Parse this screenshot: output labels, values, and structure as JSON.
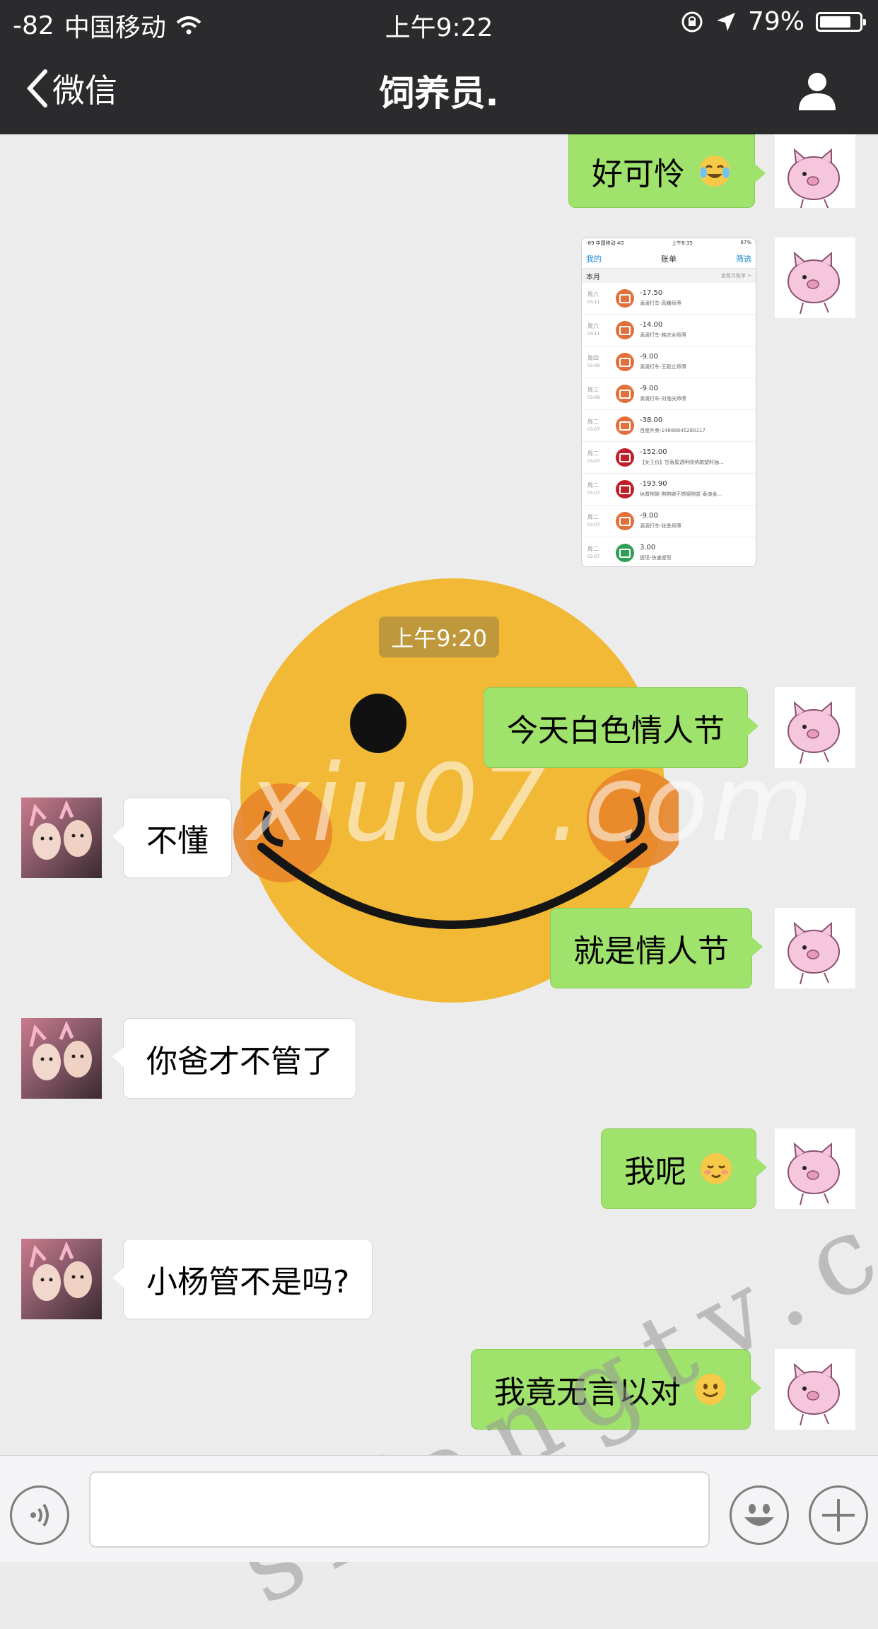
{
  "status_bar": {
    "signal": "-82",
    "carrier": "中国移动",
    "time": "上午9:22",
    "battery": "79%",
    "battery_level": 0.79
  },
  "nav": {
    "back_label": "微信",
    "title": "饲养员."
  },
  "screenshot_image": {
    "status_left": "-89 中国移动  4G",
    "status_time": "上午8:35",
    "status_right": "67%",
    "back_label": "我的",
    "title": "账单",
    "filter_label": "筛选",
    "month_label": "本月",
    "month_right": "查看月账单 >",
    "rows": [
      {
        "day": "周六",
        "date": "03-11",
        "amount": "-17.50",
        "desc": "滴滴打车-高巍师傅",
        "color": "#e3703a"
      },
      {
        "day": "周六",
        "date": "03-11",
        "amount": "-14.00",
        "desc": "滴滴打车-韩庆全师傅",
        "color": "#e3703a"
      },
      {
        "day": "周四",
        "date": "03-09",
        "amount": "-9.00",
        "desc": "滴滴打车-王毅立师傅",
        "color": "#e3703a"
      },
      {
        "day": "周三",
        "date": "03-08",
        "amount": "-9.00",
        "desc": "滴滴打车-刘逸庆师傅",
        "color": "#e3703a"
      },
      {
        "day": "周二",
        "date": "03-07",
        "amount": "-38.00",
        "desc": "百度外卖-14888845280317",
        "color": "#e3703a"
      },
      {
        "day": "周二",
        "date": "03-07",
        "amount": "-152.00",
        "desc": "【女王价】甘香屋透明收纳箱塑料抽...",
        "color": "#c0202a"
      },
      {
        "day": "周二",
        "date": "03-07",
        "amount": "-193.90",
        "desc": "休普狗碗 狗狗碗不锈钢狗盆 泰迪金...",
        "color": "#c0202a"
      },
      {
        "day": "周二",
        "date": "03-07",
        "amount": "-9.00",
        "desc": "滴滴打车-张勇师傅",
        "color": "#e3703a"
      },
      {
        "day": "周二",
        "date": "03-07",
        "amount": "3.00",
        "desc": "提现-快速提现",
        "color": "#2f9e57"
      }
    ]
  },
  "messages": {
    "m1": "好可怜",
    "timestamp": "上午9:20",
    "m2": "今天白色情人节",
    "m3": "不懂",
    "m4": "就是情人节",
    "m5": "你爸才不管了",
    "m6": "我呢",
    "m7": "小杨管不是吗?",
    "m8": "我竟无言以对"
  },
  "watermarks": {
    "w1": "xiu07.com",
    "w2": "sifangtv.com"
  },
  "colors": {
    "header_bg": "#2b2b2e",
    "my_bubble": "#9fe26c",
    "their_bubble": "#ffffff",
    "timestamp_bg": "#b08e3c"
  }
}
